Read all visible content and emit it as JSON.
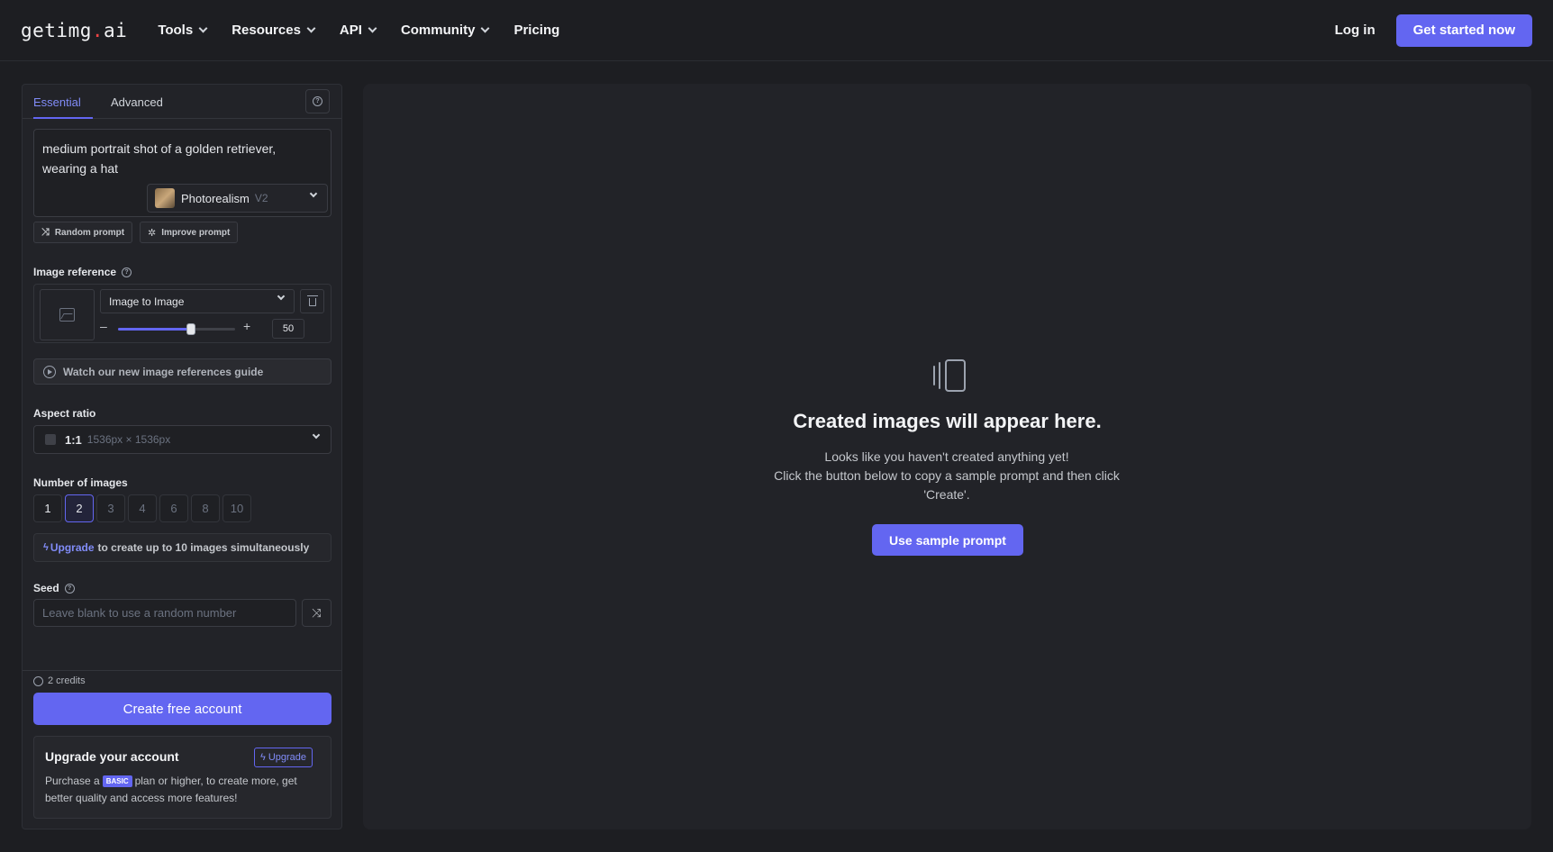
{
  "header": {
    "logo": {
      "prefix": "getimg",
      "dot": ".",
      "suffix": "ai"
    },
    "nav": [
      {
        "label": "Tools",
        "dropdown": true
      },
      {
        "label": "Resources",
        "dropdown": true
      },
      {
        "label": "API",
        "dropdown": true
      },
      {
        "label": "Community",
        "dropdown": true
      },
      {
        "label": "Pricing",
        "dropdown": false
      }
    ],
    "login_label": "Log in",
    "cta_label": "Get started now"
  },
  "panel": {
    "tabs": [
      {
        "label": "Essential",
        "active": true
      },
      {
        "label": "Advanced",
        "active": false
      }
    ],
    "prompt": {
      "value": "medium portrait shot of a golden retriever, wearing a hat"
    },
    "model": {
      "name": "Photorealism",
      "version": "V2"
    },
    "random_prompt_label": "Random prompt",
    "improve_prompt_label": "Improve prompt",
    "image_reference": {
      "label": "Image reference",
      "mode": "Image to Image",
      "strength": 50,
      "minus": "–",
      "plus": "+"
    },
    "guide_label": "Watch our new image references guide",
    "aspect_ratio": {
      "label": "Aspect ratio",
      "value": "1:1",
      "dimensions": "1536px × 1536px"
    },
    "number_of_images": {
      "label": "Number of images",
      "options": [
        "1",
        "2",
        "3",
        "4",
        "6",
        "8",
        "10"
      ],
      "selected": "2",
      "enabled": [
        "1",
        "2"
      ]
    },
    "upgrade_note": {
      "link": "Upgrade",
      "text": "to create up to 10 images simultaneously"
    },
    "seed": {
      "label": "Seed",
      "placeholder": "Leave blank to use a random number"
    },
    "credits": "2 credits",
    "create_label": "Create free account",
    "upgrade_card": {
      "title": "Upgrade your account",
      "button": "Upgrade",
      "text_before": "Purchase a",
      "badge": "BASIC",
      "text_after": "plan or higher, to create more, get better quality and access more features!"
    }
  },
  "main": {
    "empty_title": "Created images will appear here.",
    "empty_lines": [
      "Looks like you haven't created anything yet!",
      "Click the button below to copy a sample prompt and then click 'Create'."
    ],
    "sample_button": "Use sample prompt"
  },
  "colors": {
    "accent": "#6366f1",
    "accent_text": "#818cf8",
    "background": "#1d1e22",
    "panel": "#222328"
  }
}
